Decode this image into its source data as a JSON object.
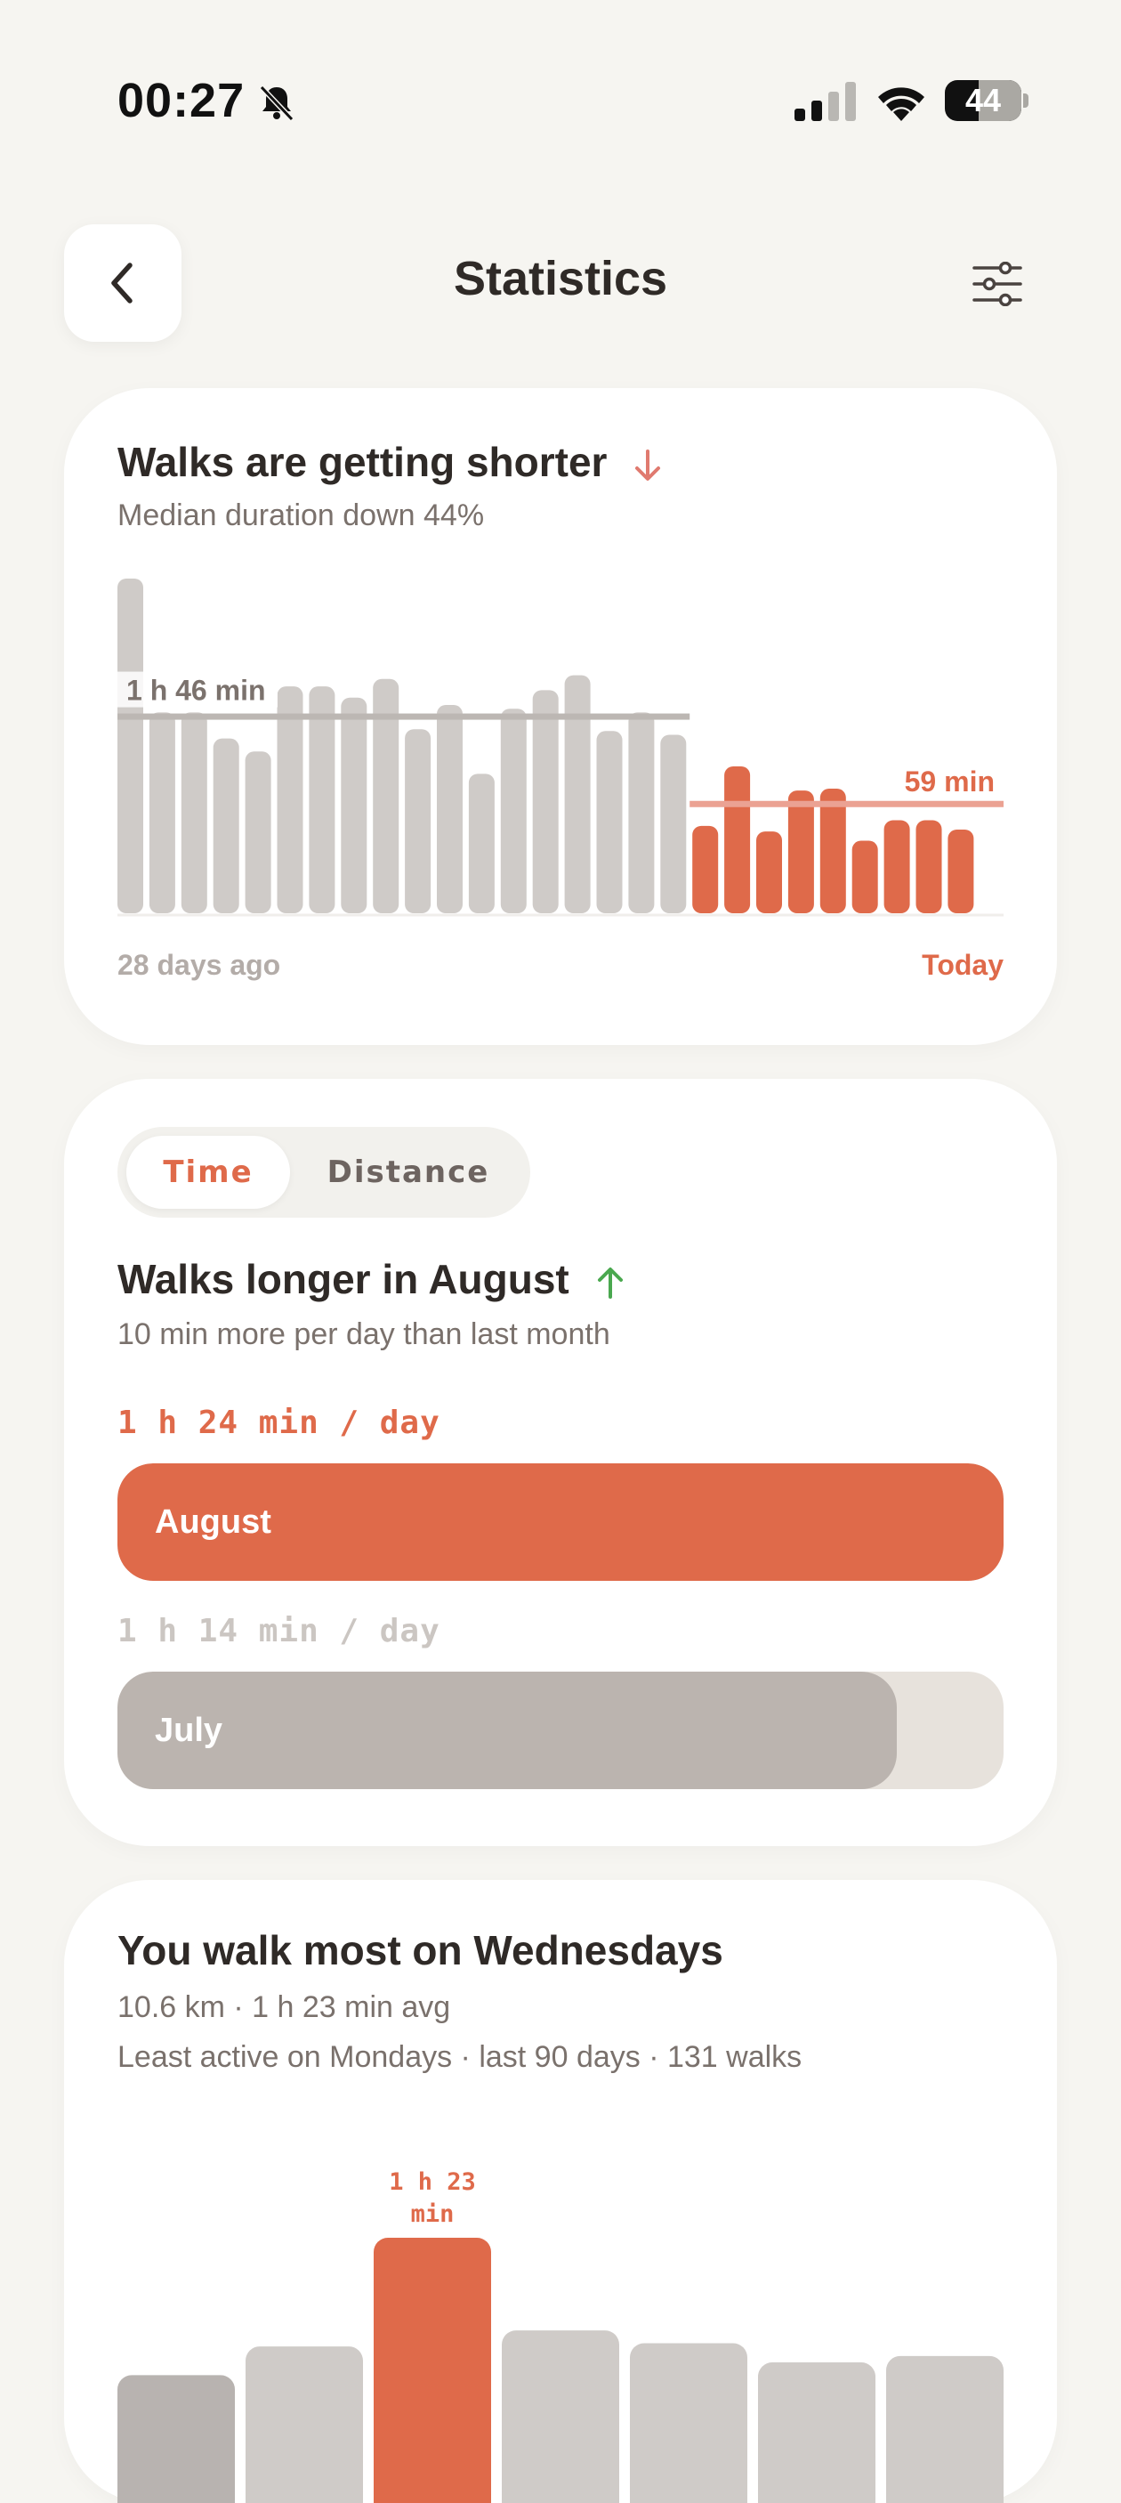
{
  "status_bar": {
    "time": "00:27",
    "battery": "44",
    "battery_level": 0.44
  },
  "header": {
    "title": "Statistics",
    "back_icon": "chevron-left-icon",
    "filter_icon": "sliders-icon"
  },
  "colors": {
    "accent": "#df6a4a",
    "muted": "#cfcbc8",
    "muted_dark": "#b8b3b0",
    "background": "#f6f5f1",
    "down_arrow": "#e07a6f",
    "up_arrow": "#4aa84f"
  },
  "duration_card": {
    "title": "Walks are getting shorter",
    "trend_icon": "arrow-down-icon",
    "subtitle": "Median duration down 44%",
    "previous_median_label": "1 h 46 min",
    "recent_median_label": "59 min",
    "start_label": "28 days ago",
    "end_label": "Today",
    "chart_data": {
      "type": "bar",
      "ylabel": "",
      "unit": "min",
      "series": [
        {
          "values": [
            180,
            108,
            108,
            94,
            87,
            122,
            122,
            116,
            126,
            99,
            112,
            75,
            110,
            120,
            128,
            98,
            108,
            96
          ]
        },
        {
          "values": [
            47,
            79,
            44,
            66,
            67,
            39,
            50,
            50,
            45,
            0
          ]
        }
      ],
      "reference_lines": [
        106,
        59
      ]
    }
  },
  "comparison_card": {
    "tabs": [
      {
        "label": "Time",
        "selected": true
      },
      {
        "label": "Distance",
        "selected": false
      }
    ],
    "title": "Walks longer in August",
    "trend_icon": "arrow-up-icon",
    "subtitle": "10 min more per day than last month",
    "current": {
      "value_label": "1 h 24 min / day",
      "month": "August",
      "fraction": 1.0
    },
    "previous": {
      "value_label": "1 h 14 min / day",
      "month": "July",
      "fraction": 0.88
    }
  },
  "weekday_card": {
    "title": "You walk most on Wednesdays",
    "subtitle_line1": "10.6 km · 1 h 23 min avg",
    "subtitle_line2": "Least active on Mondays · last 90 days · 131 walks",
    "peak_label_line1": "1 h 23",
    "peak_label_line2": "min",
    "chart_data": {
      "type": "bar",
      "unit": "min",
      "values": [
        40,
        49,
        83,
        54,
        50,
        44,
        46
      ],
      "highlight_index": 2,
      "dim_index": 0
    }
  }
}
